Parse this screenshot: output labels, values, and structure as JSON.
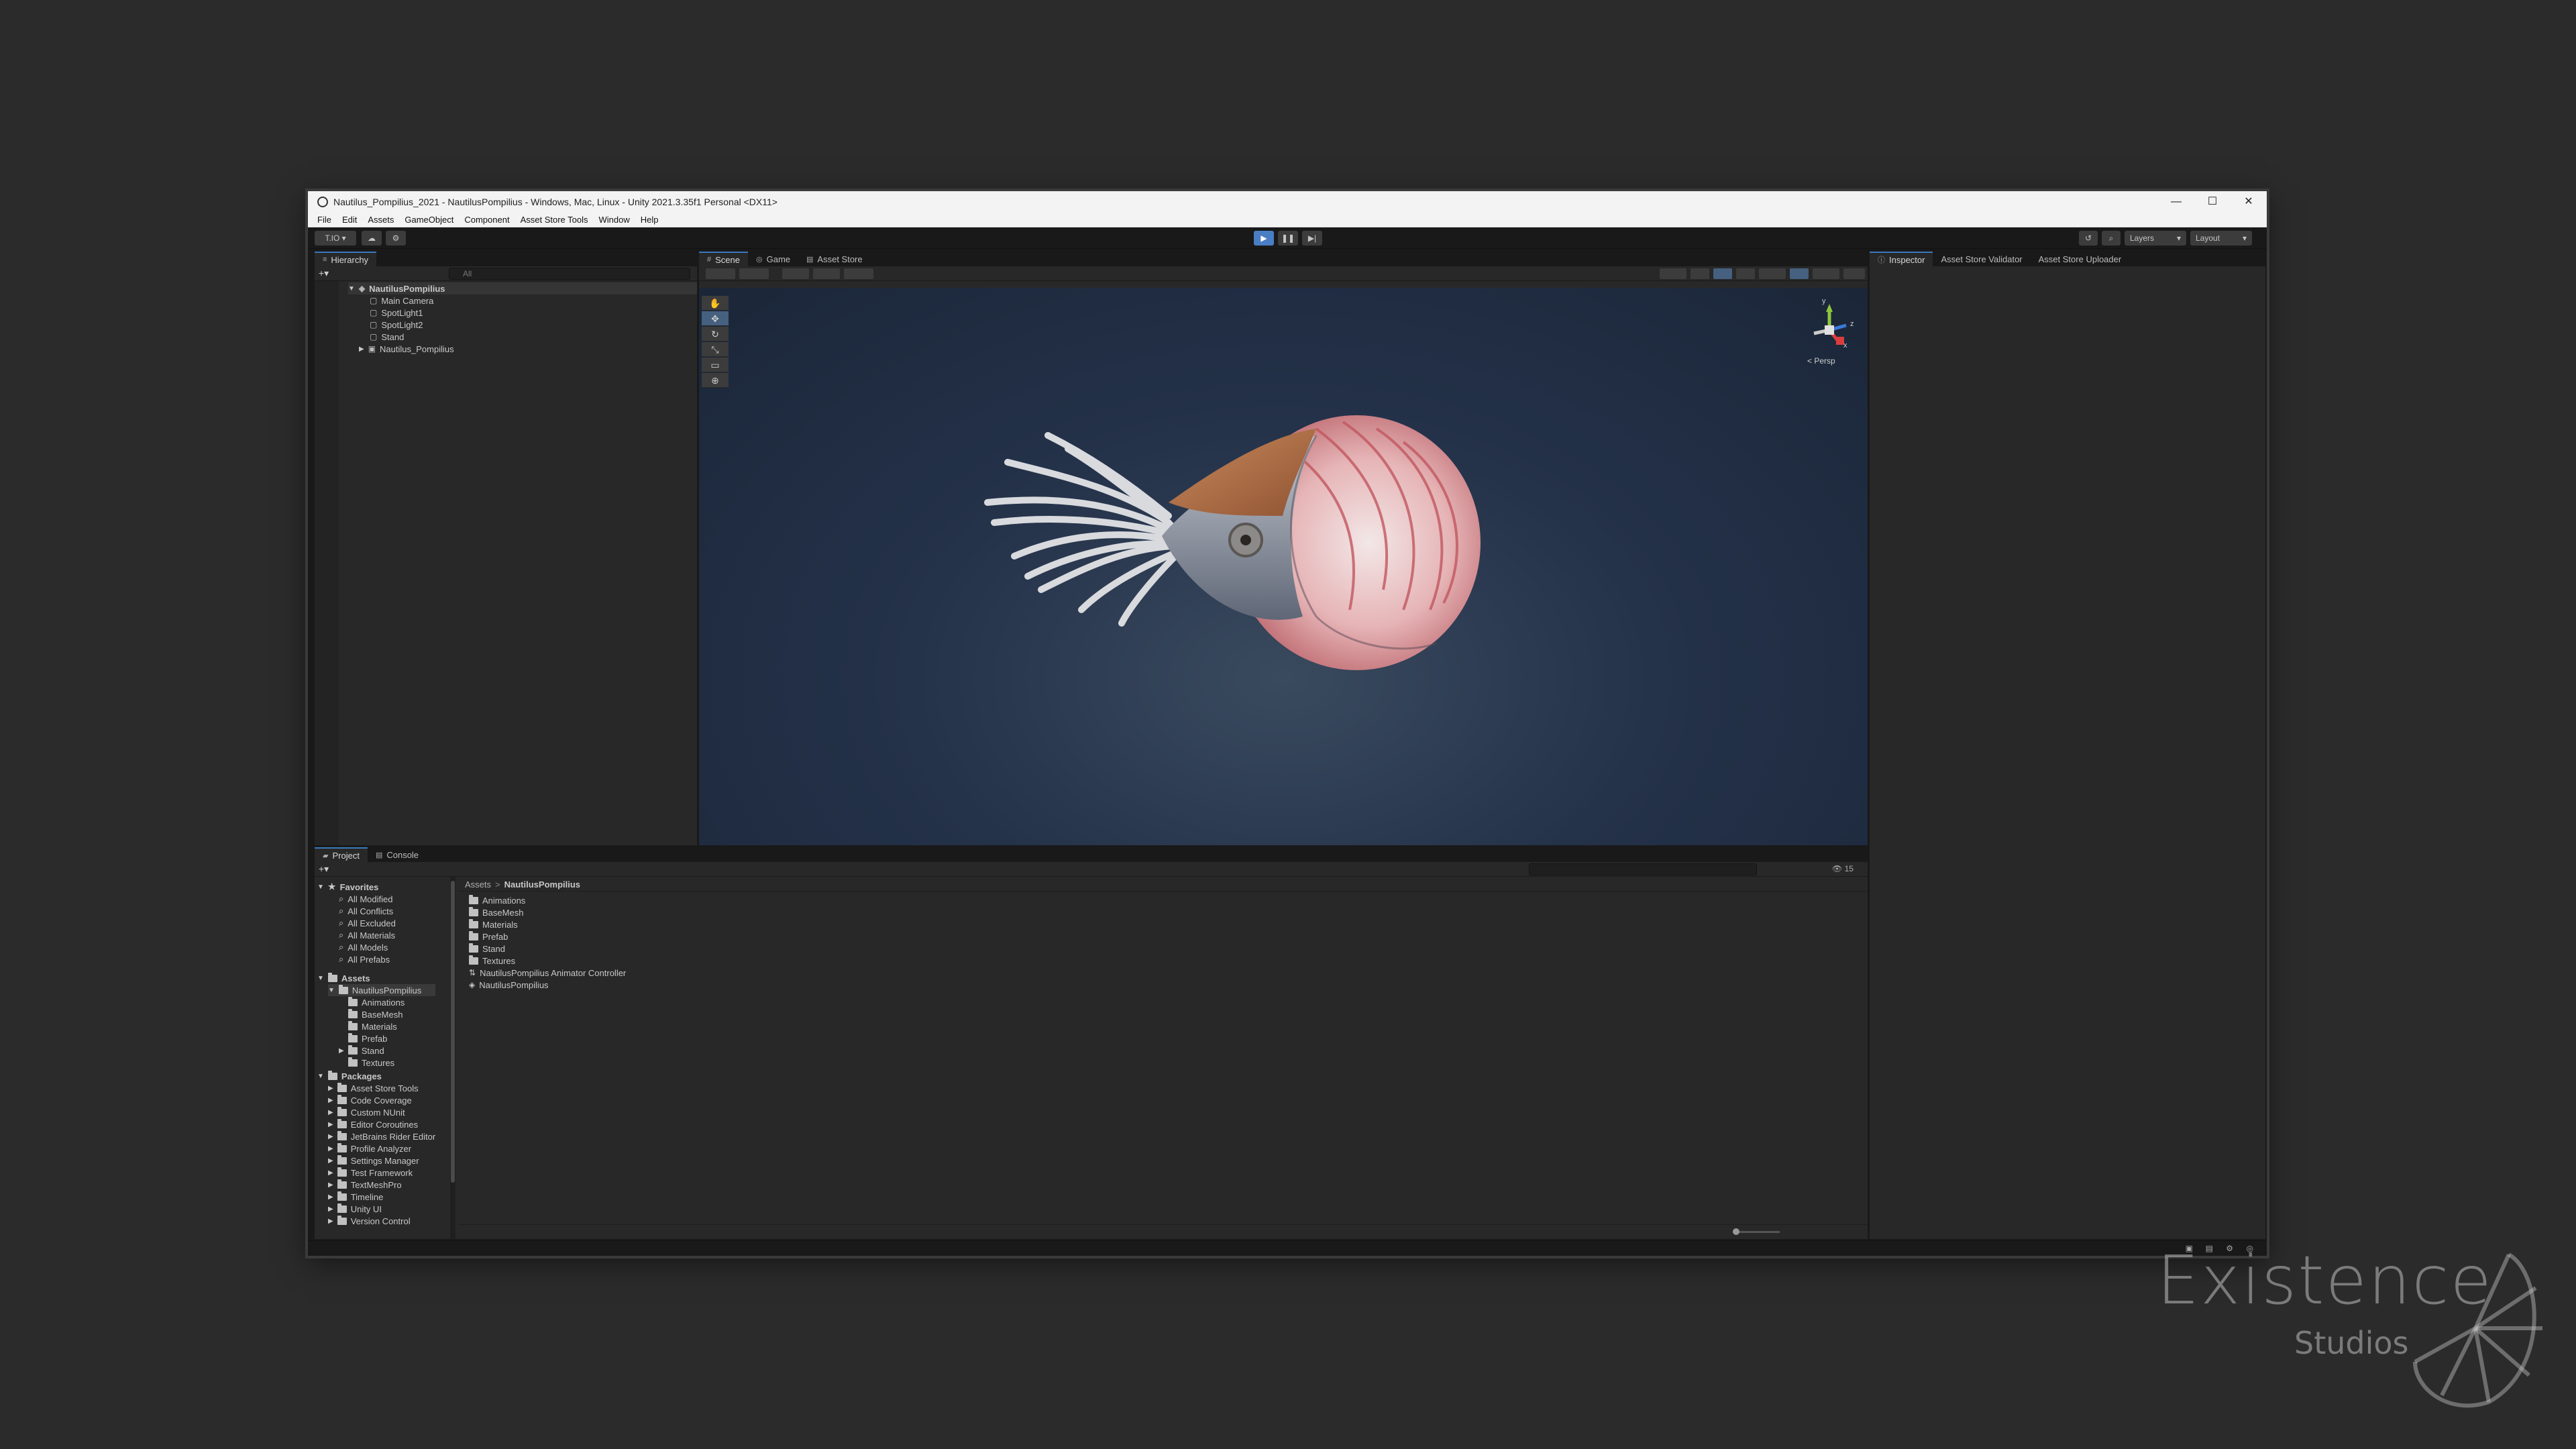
{
  "window": {
    "title": "Nautilus_Pompilius_2021 - NautilusPompilius - Windows, Mac, Linux - Unity 2021.3.35f1 Personal <DX11>",
    "controls": {
      "minimize": "—",
      "maximize": "☐",
      "close": "✕"
    }
  },
  "menu": [
    "File",
    "Edit",
    "Assets",
    "GameObject",
    "Component",
    "Asset Store Tools",
    "Window",
    "Help"
  ],
  "toolbar": {
    "account_label": "T.IO",
    "layers_label": "Layers",
    "layout_label": "Layout"
  },
  "hierarchy": {
    "tab": "Hierarchy",
    "search_placeholder": "All",
    "scene": "NautilusPompilius",
    "items": [
      "Main Camera",
      "SpotLight1",
      "SpotLight2",
      "Stand",
      "Nautilus_Pompilius"
    ]
  },
  "scene_tabs": [
    "Scene",
    "Game",
    "Asset Store"
  ],
  "gizmo": {
    "persp_label": "< Persp",
    "x": "x",
    "y": "y",
    "z": "z"
  },
  "inspector_tabs": [
    "Inspector",
    "Asset Store Validator",
    "Asset Store Uploader"
  ],
  "project": {
    "tabs": [
      "Project",
      "Console"
    ],
    "favorites_label": "Favorites",
    "favorites": [
      "All Modified",
      "All Conflicts",
      "All Excluded",
      "All Materials",
      "All Models",
      "All Prefabs"
    ],
    "assets_label": "Assets",
    "asset_tree_root": "NautilusPompilius",
    "asset_tree_children": [
      "Animations",
      "BaseMesh",
      "Materials",
      "Prefab",
      "Stand",
      "Textures"
    ],
    "packages_label": "Packages",
    "packages": [
      "Asset Store Tools",
      "Code Coverage",
      "Custom NUnit",
      "Editor Coroutines",
      "JetBrains Rider Editor",
      "Profile Analyzer",
      "Settings Manager",
      "Test Framework",
      "TextMeshPro",
      "Timeline",
      "Unity UI",
      "Version Control"
    ],
    "breadcrumb_root": "Assets",
    "breadcrumb_sep": ">",
    "breadcrumb_current": "NautilusPompilius",
    "contents": [
      "Animations",
      "BaseMesh",
      "Materials",
      "Prefab",
      "Stand",
      "Textures",
      "NautilusPompilius Animator Controller",
      "NautilusPompilius"
    ],
    "hidden_count": "15"
  },
  "watermark": {
    "main": "Existence",
    "sub": "Studios"
  },
  "colors": {
    "accent": "#3a79bb",
    "play": "#4a7ec4",
    "panel": "#282828",
    "toolbar": "#191919"
  }
}
